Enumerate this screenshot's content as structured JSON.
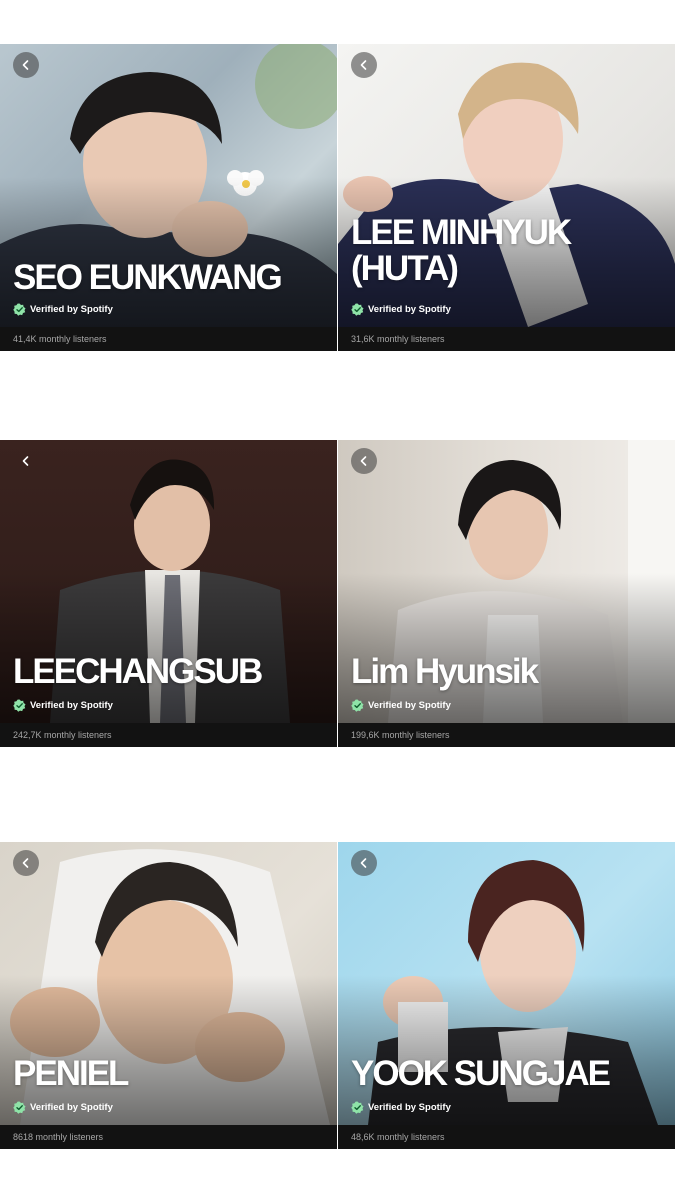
{
  "page": {
    "background": "#ffffff",
    "accent": "#1ed760"
  },
  "artists": [
    {
      "name": "SEO EUNKWANG",
      "verified_label": "Verified by Spotify",
      "listeners": "41,4K monthly listeners",
      "icon": "back-chevron-icon"
    },
    {
      "name": "LEE MINHYUK (HUTA)",
      "verified_label": "Verified by Spotify",
      "listeners": "31,6K monthly listeners",
      "icon": "back-chevron-icon"
    },
    {
      "name": "LEECHANGSUB",
      "verified_label": "Verified by Spotify",
      "listeners": "242,7K monthly listeners",
      "icon": "back-chevron-icon"
    },
    {
      "name": "Lim Hyunsik",
      "verified_label": "Verified by Spotify",
      "listeners": "199,6K monthly listeners",
      "icon": "back-chevron-icon"
    },
    {
      "name": "PENIEL",
      "verified_label": "Verified by Spotify",
      "listeners": "8618 monthly listeners",
      "icon": "back-chevron-icon"
    },
    {
      "name": "YOOK SUNGJAE",
      "verified_label": "Verified by Spotify",
      "listeners": "48,6K monthly listeners",
      "icon": "back-chevron-icon"
    }
  ]
}
